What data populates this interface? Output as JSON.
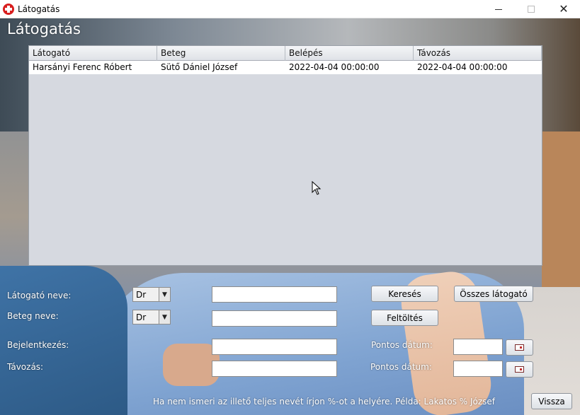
{
  "window": {
    "title": "Látogatás",
    "minimize_glyph": "—",
    "maximize_glyph": "☐",
    "close_glyph": "✕"
  },
  "app": {
    "heading": "Látogatás"
  },
  "table": {
    "columns": [
      "Látogató",
      "Beteg",
      "Belépés",
      "Távozás"
    ],
    "rows": [
      [
        "Harsányi Ferenc Róbert",
        "Sütő Dániel József",
        "2022-04-04 00:00:00",
        "2022-04-04 00:00:00"
      ]
    ]
  },
  "form": {
    "visitor_label": "Látogató neve:",
    "visitor_prefix": "Dr",
    "visitor_value": "",
    "patient_label": "Beteg neve:",
    "patient_prefix": "Dr",
    "patient_value": "",
    "checkin_label": "Bejelentkezés:",
    "checkin_value": "",
    "checkout_label": "Távozás:",
    "checkout_value": "",
    "exact_date_label_1": "Pontos dátum:",
    "exact_date_value_1": "",
    "exact_date_label_2": "Pontos dátum:",
    "exact_date_value_2": ""
  },
  "buttons": {
    "search": "Keresés",
    "all_visitors": "Összes látogató",
    "upload": "Feltöltés",
    "back": "Vissza"
  },
  "hint": "Ha nem ismeri az illető teljes nevét írjon %-ot a helyére. Példa: Lakatos % József",
  "icons": {
    "app": "red-cross-icon",
    "calendar": "calendar-icon",
    "dropdown": "chevron-down-icon",
    "cursor": "mouse-cursor-icon"
  },
  "colors": {
    "accent_red": "#d81e1e",
    "table_bg": "#d6d9e0",
    "selected_row": "#ffffff"
  }
}
